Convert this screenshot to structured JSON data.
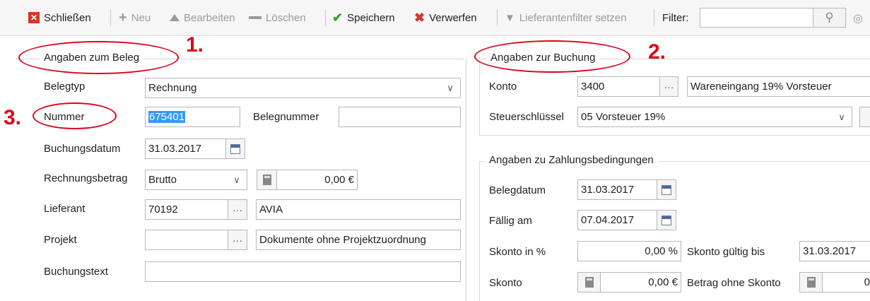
{
  "toolbar": {
    "close_label": "Schließen",
    "new_label": "Neu",
    "edit_label": "Bearbeiten",
    "delete_label": "Löschen",
    "save_label": "Speichern",
    "discard_label": "Verwerfen",
    "supplier_filter_label": "Lieferantenfilter setzen",
    "filter_label": "Filter:",
    "filter_value": ""
  },
  "beleg": {
    "title": "Angaben zum Beleg",
    "belegtyp_label": "Belegtyp",
    "belegtyp_value": "Rechnung",
    "nummer_label": "Nummer",
    "nummer_value": "675401",
    "belegnummer_label": "Belegnummer",
    "belegnummer_value": "",
    "buchungsdatum_label": "Buchungsdatum",
    "buchungsdatum_value": "31.03.2017",
    "rechnungsbetrag_label": "Rechnungsbetrag",
    "rechnungsbetrag_type": "Brutto",
    "rechnungsbetrag_value": "0,00 €",
    "lieferant_label": "Lieferant",
    "lieferant_nr": "70192",
    "lieferant_name": "AVIA",
    "projekt_label": "Projekt",
    "projekt_nr": "",
    "projekt_name": "Dokumente ohne Projektzuordnung",
    "buchungstext_label": "Buchungstext",
    "buchungstext_value": ""
  },
  "buchung": {
    "title": "Angaben zur Buchung",
    "konto_label": "Konto",
    "konto_value": "3400",
    "konto_name": "Wareneingang 19% Vorsteuer",
    "steuer_label": "Steuerschlüssel",
    "steuer_value": "05 Vorsteuer 19%"
  },
  "zahlung": {
    "title": "Angaben zu Zahlungsbedingungen",
    "belegdatum_label": "Belegdatum",
    "belegdatum_value": "31.03.2017",
    "faellig_label": "Fällig am",
    "faellig_value": "07.04.2017",
    "skonto_pct_label": "Skonto in %",
    "skonto_pct_value": "0,00 %",
    "skonto_gueltig_label": "Skonto gültig bis",
    "skonto_gueltig_value": "31.03.2017",
    "skonto_label": "Skonto",
    "skonto_value": "0,00 €",
    "ohne_skonto_label": "Betrag ohne Skonto",
    "ohne_skonto_value": "0"
  },
  "annotations": {
    "n1": "1.",
    "n2": "2.",
    "n3": "3."
  },
  "colors": {
    "annotation": "#e0001a",
    "selection": "#3399ff"
  }
}
